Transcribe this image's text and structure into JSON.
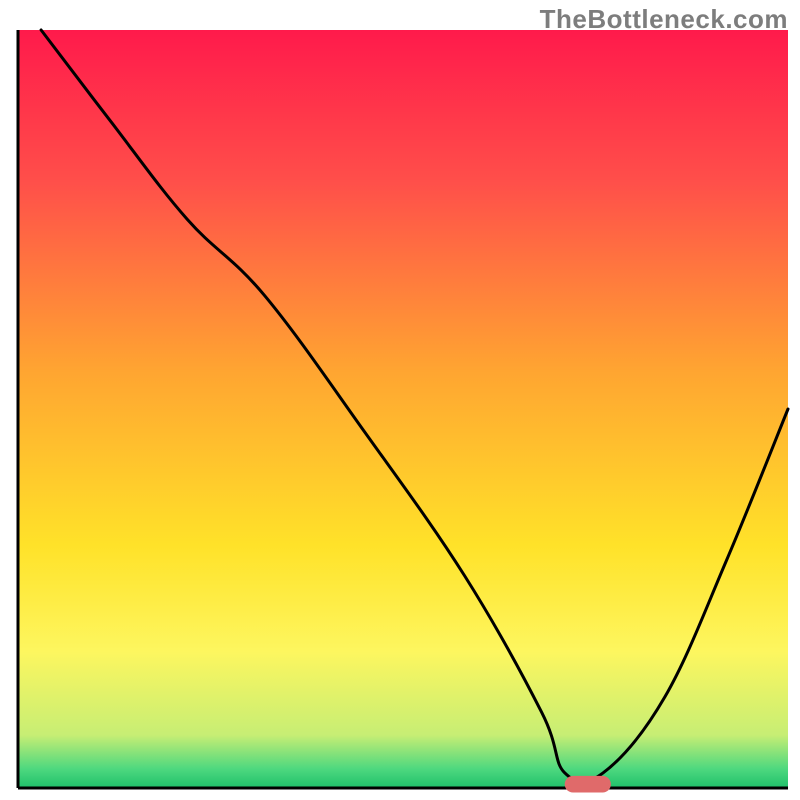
{
  "watermark": "TheBottleneck.com",
  "chart_data": {
    "type": "line",
    "title": "",
    "xlabel": "",
    "ylabel": "",
    "xlim": [
      0,
      100
    ],
    "ylim": [
      0,
      100
    ],
    "grid": false,
    "legend": false,
    "gradient_stops": [
      {
        "offset": 0.0,
        "color": "#ff1a4b"
      },
      {
        "offset": 0.2,
        "color": "#ff4f4a"
      },
      {
        "offset": 0.45,
        "color": "#ffa531"
      },
      {
        "offset": 0.68,
        "color": "#ffe229"
      },
      {
        "offset": 0.82,
        "color": "#fdf65f"
      },
      {
        "offset": 0.93,
        "color": "#c7ee74"
      },
      {
        "offset": 0.975,
        "color": "#4dd87f"
      },
      {
        "offset": 1.0,
        "color": "#1fc06a"
      }
    ],
    "series": [
      {
        "name": "bottleneck-curve",
        "color": "#000000",
        "x": [
          3,
          12,
          22,
          32,
          45,
          58,
          68,
          71,
          76,
          84,
          92,
          100
        ],
        "y": [
          100,
          88,
          75,
          65,
          47,
          28,
          10,
          2,
          2,
          12,
          30,
          50
        ]
      }
    ],
    "marker": {
      "name": "optimal-range",
      "color": "#e06a6a",
      "x_start": 71,
      "x_end": 77,
      "y": 0.5,
      "thickness": 2.2
    }
  }
}
